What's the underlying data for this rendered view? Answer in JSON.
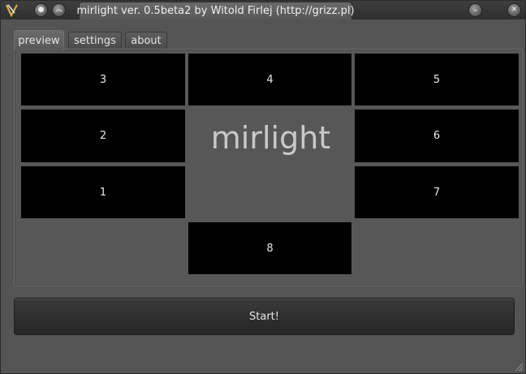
{
  "window": {
    "title": "mirlight ver. 0.5beta2 by Witold Firlej (http://grizz.pl)",
    "icons": {
      "app": "app-logo-icon",
      "left_btn1": "circle-icon",
      "left_btn2": "chevrons-up-icon",
      "minimize": "chevron-down-icon",
      "close": "close-icon"
    }
  },
  "tabs": [
    {
      "label": "preview",
      "active": true
    },
    {
      "label": "settings",
      "active": false
    },
    {
      "label": "about",
      "active": false
    }
  ],
  "preview": {
    "logo_text": "mirlight",
    "zones": [
      "3",
      "4",
      "5",
      "2",
      "6",
      "1",
      "7",
      "8"
    ]
  },
  "actions": {
    "start_label": "Start!"
  },
  "colors": {
    "zone_bg": "#000000",
    "window_bg": "#545454",
    "titlebar": "#333333"
  }
}
